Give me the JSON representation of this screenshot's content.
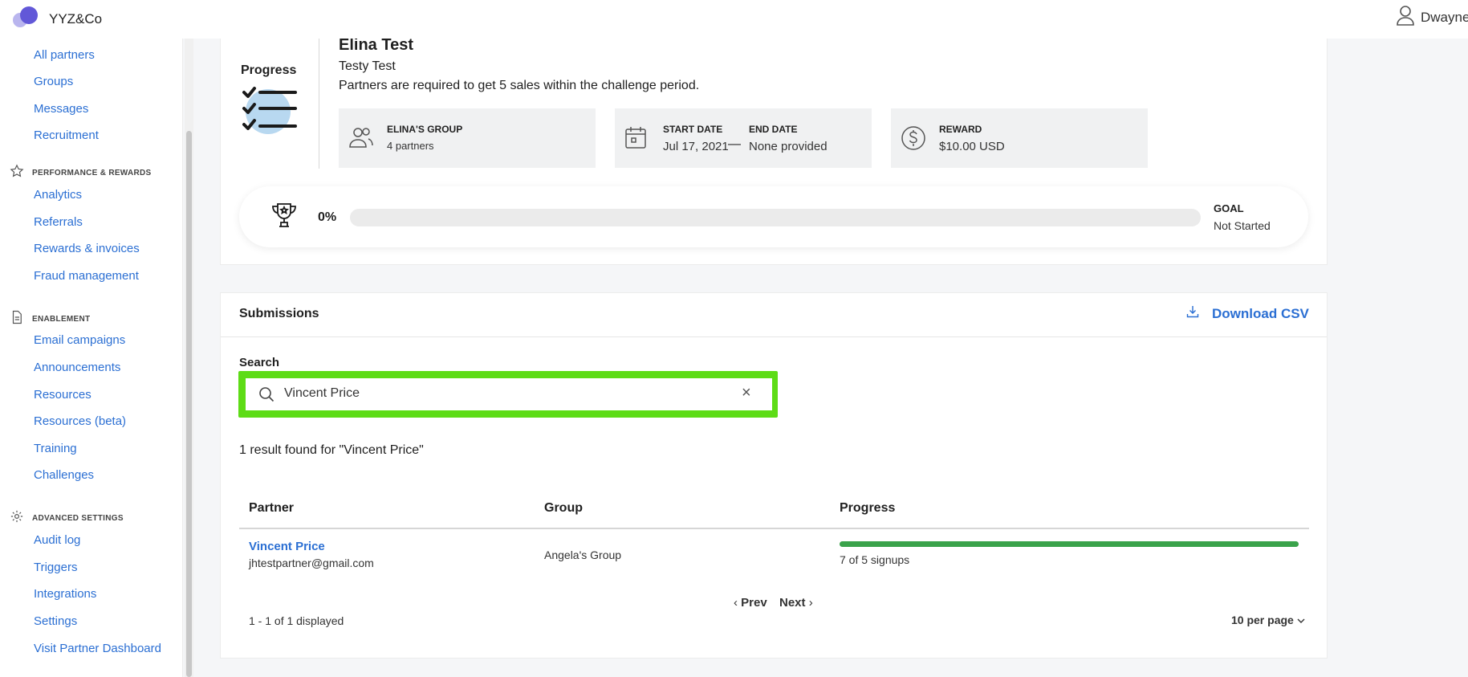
{
  "app": {
    "brand": "YYZ&Co",
    "user_name": "Dwayne"
  },
  "sidebar": {
    "top_items": [
      {
        "label": "All partners"
      },
      {
        "label": "Groups"
      },
      {
        "label": "Messages"
      },
      {
        "label": "Recruitment"
      }
    ],
    "sections": [
      {
        "title": "PERFORMANCE & REWARDS",
        "icon": "star-icon",
        "items": [
          {
            "label": "Analytics"
          },
          {
            "label": "Referrals"
          },
          {
            "label": "Rewards & invoices"
          },
          {
            "label": "Fraud management"
          }
        ]
      },
      {
        "title": "ENABLEMENT",
        "icon": "document-icon",
        "items": [
          {
            "label": "Email campaigns"
          },
          {
            "label": "Announcements"
          },
          {
            "label": "Resources"
          },
          {
            "label": "Resources (beta)"
          },
          {
            "label": "Training"
          },
          {
            "label": "Challenges"
          }
        ]
      },
      {
        "title": "ADVANCED SETTINGS",
        "icon": "gear-icon",
        "items": [
          {
            "label": "Audit log"
          },
          {
            "label": "Triggers"
          },
          {
            "label": "Integrations"
          },
          {
            "label": "Settings"
          },
          {
            "label": "Visit Partner Dashboard"
          }
        ]
      }
    ]
  },
  "challenge": {
    "progress_label": "Progress",
    "title": "Elina Test",
    "subtitle": "Testy Test",
    "description": "Partners are required to get 5 sales within the challenge period.",
    "group": {
      "name": "ELINA'S GROUP",
      "count": "4 partners"
    },
    "dates": {
      "start_label": "START DATE",
      "start": "Jul 17, 2021",
      "separator": "—",
      "end_label": "END DATE",
      "end": "None provided"
    },
    "reward": {
      "label": "REWARD",
      "value": "$10.00 USD"
    },
    "goal": {
      "percent_text": "0%",
      "progress": 0,
      "label": "GOAL",
      "status": "Not Started"
    }
  },
  "submissions": {
    "title": "Submissions",
    "download_label": "Download CSV",
    "search": {
      "label": "Search",
      "value": "Vincent Price",
      "placeholder": ""
    },
    "result_text": "1 result found for \"Vincent Price\"",
    "columns": [
      "Partner",
      "Group",
      "Progress"
    ],
    "rows": [
      {
        "partner": "Vincent Price",
        "email": "jhtestpartner@gmail.com",
        "group": "Angela's Group",
        "progress_text": "7 of 5 signups",
        "progress": 1.0,
        "progress_color": "#3aa34b"
      }
    ],
    "pagination": {
      "prev": "Prev",
      "next": "Next",
      "displayed": "1 - 1 of 1 displayed",
      "per_page": "10 per page"
    }
  },
  "colors": {
    "link": "#2b6fd3",
    "highlight": "#5ddc16",
    "progress": "#3aa34b"
  }
}
